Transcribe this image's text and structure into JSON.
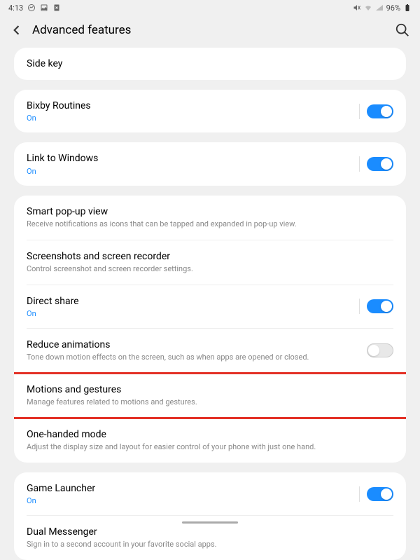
{
  "status": {
    "time": "4:13",
    "battery": "96%"
  },
  "header": {
    "title": "Advanced features"
  },
  "groups": {
    "g1": {
      "r0": {
        "title": "Side key"
      }
    },
    "g2": {
      "r0": {
        "title": "Bixby Routines",
        "status": "On"
      }
    },
    "g3": {
      "r0": {
        "title": "Link to Windows",
        "status": "On"
      }
    },
    "g4": {
      "r0": {
        "title": "Smart pop-up view",
        "sub": "Receive notifications as icons that can be tapped and expanded in pop-up view."
      },
      "r1": {
        "title": "Screenshots and screen recorder",
        "sub": "Control screenshot and screen recorder settings."
      },
      "r2": {
        "title": "Direct share",
        "status": "On"
      },
      "r3": {
        "title": "Reduce animations",
        "sub": "Tone down motion effects on the screen, such as when apps are opened or closed."
      },
      "r4": {
        "title": "Motions and gestures",
        "sub": "Manage features related to motions and gestures."
      },
      "r5": {
        "title": "One-handed mode",
        "sub": "Adjust the display size and layout for easier control of your phone with just one hand."
      }
    },
    "g5": {
      "r0": {
        "title": "Game Launcher",
        "status": "On"
      },
      "r1": {
        "title": "Dual Messenger",
        "sub": "Sign in to a second account in your favorite social apps."
      }
    }
  }
}
